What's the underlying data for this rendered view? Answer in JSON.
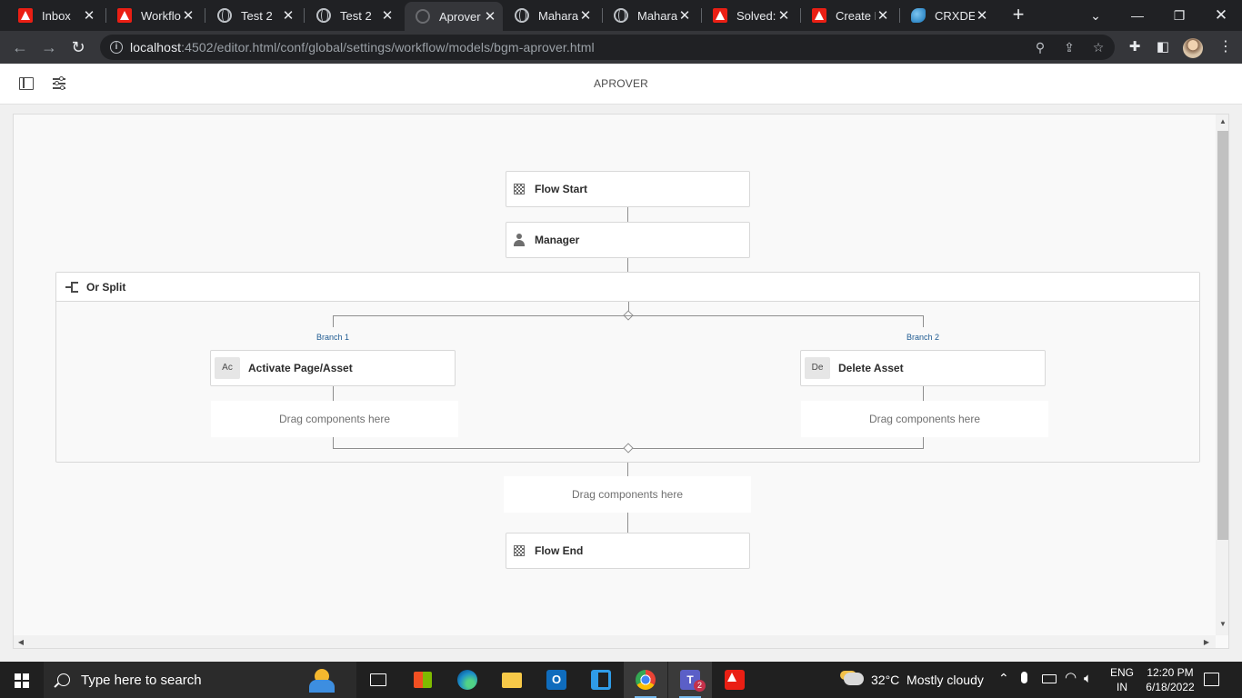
{
  "browser": {
    "tabs": [
      {
        "label": "Inbox",
        "icon": "adobe-icon",
        "active": false
      },
      {
        "label": "Workflo",
        "icon": "adobe-icon",
        "active": false
      },
      {
        "label": "Test 2",
        "icon": "globe-icon",
        "active": false
      },
      {
        "label": "Test 2",
        "icon": "globe-icon",
        "active": false
      },
      {
        "label": "Aprover",
        "icon": "loading-spinner-icon",
        "active": true
      },
      {
        "label": "Maharas",
        "icon": "globe-icon",
        "active": false
      },
      {
        "label": "Maharas",
        "icon": "globe-icon",
        "active": false
      },
      {
        "label": "Solved: I",
        "icon": "adobe-icon",
        "active": false
      },
      {
        "label": "Create P",
        "icon": "adobe-icon",
        "active": false
      },
      {
        "label": "CRXDE L",
        "icon": "crxde-icon",
        "active": false
      }
    ],
    "url_host": "localhost",
    "url_rest": ":4502/editor.html/conf/global/settings/workflow/models/bgm-aprover.html"
  },
  "editor": {
    "title": "APROVER"
  },
  "workflow": {
    "flow_start": "Flow Start",
    "manager": "Manager",
    "or_split": "Or Split",
    "branch1_label": "Branch 1",
    "branch2_label": "Branch 2",
    "branch1_step": {
      "abbr": "Ac",
      "title": "Activate Page/Asset"
    },
    "branch2_step": {
      "abbr": "De",
      "title": "Delete Asset"
    },
    "dropzone_text": "Drag components here",
    "flow_end": "Flow End"
  },
  "taskbar": {
    "search_placeholder": "Type here to search",
    "weather": "32°C  Mostly cloudy",
    "lang_top": "ENG",
    "lang_bottom": "IN",
    "time": "12:20 PM",
    "date": "6/18/2022",
    "teams_badge": "2"
  },
  "colors": {
    "chrome_dark": "#202124",
    "chrome_toolbar": "#35363a",
    "branch_label": "#1f5b92",
    "taskbar": "#202020",
    "adobe_red": "#ea1f14"
  }
}
